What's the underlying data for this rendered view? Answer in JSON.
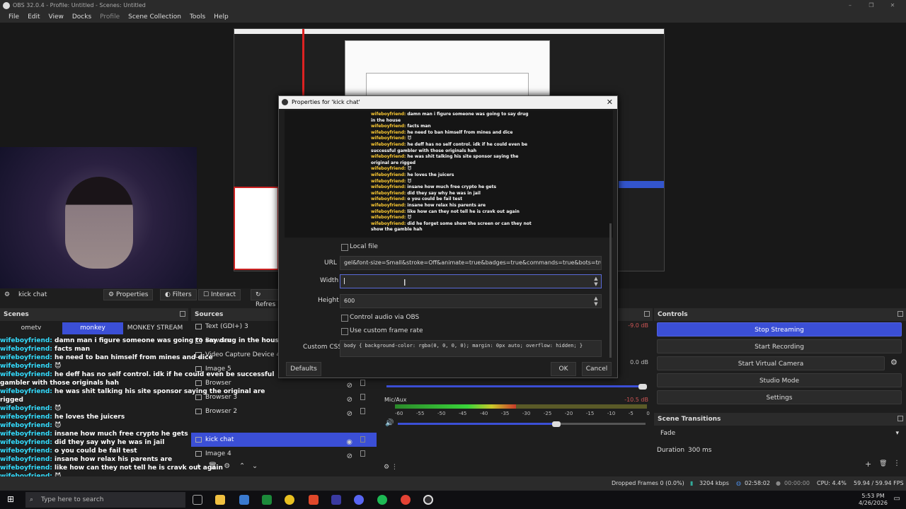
{
  "window": {
    "title": "OBS 32.0.4 - Profile: Untitled - Scenes: Untitled"
  },
  "menu": [
    "File",
    "Edit",
    "View",
    "Docks",
    "Profile",
    "Scene Collection",
    "Tools",
    "Help"
  ],
  "toolbar": {
    "source_name": "kick chat",
    "properties": "Properties",
    "filters": "Filters",
    "interact": "Interact",
    "refresh": "Refres"
  },
  "scenes": {
    "title": "Scenes",
    "items": [
      "ometv",
      "monkey",
      "MONKEY STREAM"
    ],
    "selected": "monkey"
  },
  "sources": {
    "title": "Sources",
    "items": [
      {
        "name": "Text (GDI+) 3"
      },
      {
        "name": "Browser"
      },
      {
        "name": "Video Capture Device 4"
      },
      {
        "name": "Image 5"
      },
      {
        "name": "Browser"
      },
      {
        "name": "Browser 3"
      },
      {
        "name": "Browser 2"
      },
      {
        "name": "kick chat"
      },
      {
        "name": "Image 4"
      }
    ]
  },
  "mixer": {
    "levels": [
      "-9.0 dB",
      "0.0 dB",
      "-10.5 dB"
    ],
    "track": "Mic/Aux",
    "mic_level": 0.48,
    "ticks": [
      "-60",
      "-55",
      "-50",
      "-45",
      "-40",
      "-35",
      "-30",
      "-25",
      "-20",
      "-15",
      "-10",
      "-5",
      "0"
    ]
  },
  "controls": {
    "title": "Controls",
    "stop_streaming": "Stop Streaming",
    "start_recording": "Start Recording",
    "start_virtual_camera": "Start Virtual Camera",
    "studio_mode": "Studio Mode",
    "settings": "Settings"
  },
  "transitions": {
    "title": "Scene Transitions",
    "selected": "Fade",
    "duration_label": "Duration",
    "duration": "300 ms"
  },
  "status": {
    "dropped": "Dropped Frames 0 (0.0%)",
    "bitrate": "3204 kbps",
    "stream_time": "02:58:02",
    "rec_time": "00:00:00",
    "cpu": "CPU: 4.4%",
    "fps": "59.94 / 59.94 FPS"
  },
  "taskbar": {
    "search": "Type here to search",
    "time": "5:53 PM",
    "date": "4/26/2026"
  },
  "dialog": {
    "title": "Properties for 'kick chat'",
    "local_file": "Local file",
    "url_label": "URL",
    "url": "gel&font-size=Small&stroke=Off&animate=true&badges=true&commands=true&bots=true",
    "width_label": "Width",
    "width": "",
    "height_label": "Height",
    "height": "600",
    "control_audio": "Control audio via OBS",
    "custom_frame_rate": "Use custom frame rate",
    "css_label": "Custom CSS",
    "css": "body { background-color: rgba(0, 0, 0, 0); margin: 0px auto; overflow: hidden; }",
    "defaults": "Defaults",
    "ok": "OK",
    "cancel": "Cancel"
  },
  "chat": [
    {
      "user": "wifeboyfriend:",
      "msg": "damn man i figure someone was going to say drug in the house"
    },
    {
      "user": "wifeboyfriend:",
      "msg": "facts man"
    },
    {
      "user": "wifeboyfriend:",
      "msg": "he need to ban himself from mines and dice"
    },
    {
      "user": "wifeboyfriend:",
      "msg": "😈"
    },
    {
      "user": "wifeboyfriend:",
      "msg": "he deff has no self control. idk if he could even be successful gambler with those originals hah"
    },
    {
      "user": "wifeboyfriend:",
      "msg": "he was shit talking his site sponsor saying the original are rigged"
    },
    {
      "user": "wifeboyfriend:",
      "msg": "😈"
    },
    {
      "user": "wifeboyfriend:",
      "msg": "he loves the juicers"
    },
    {
      "user": "wifeboyfriend:",
      "msg": "😈"
    },
    {
      "user": "wifeboyfriend:",
      "msg": "insane how much free crypto he gets"
    },
    {
      "user": "wifeboyfriend:",
      "msg": "did they say why he was in jail"
    },
    {
      "user": "wifeboyfriend:",
      "msg": "o you could be fail test"
    },
    {
      "user": "wifeboyfriend:",
      "msg": "insane how relax his parents are"
    },
    {
      "user": "wifeboyfriend:",
      "msg": "like how can they not tell he is cravk out again"
    },
    {
      "user": "wifeboyfriend:",
      "msg": "😈"
    },
    {
      "user": "wifeboyfriend:",
      "msg": "did he forget some show the screen or can they not show the gamble hah"
    }
  ]
}
